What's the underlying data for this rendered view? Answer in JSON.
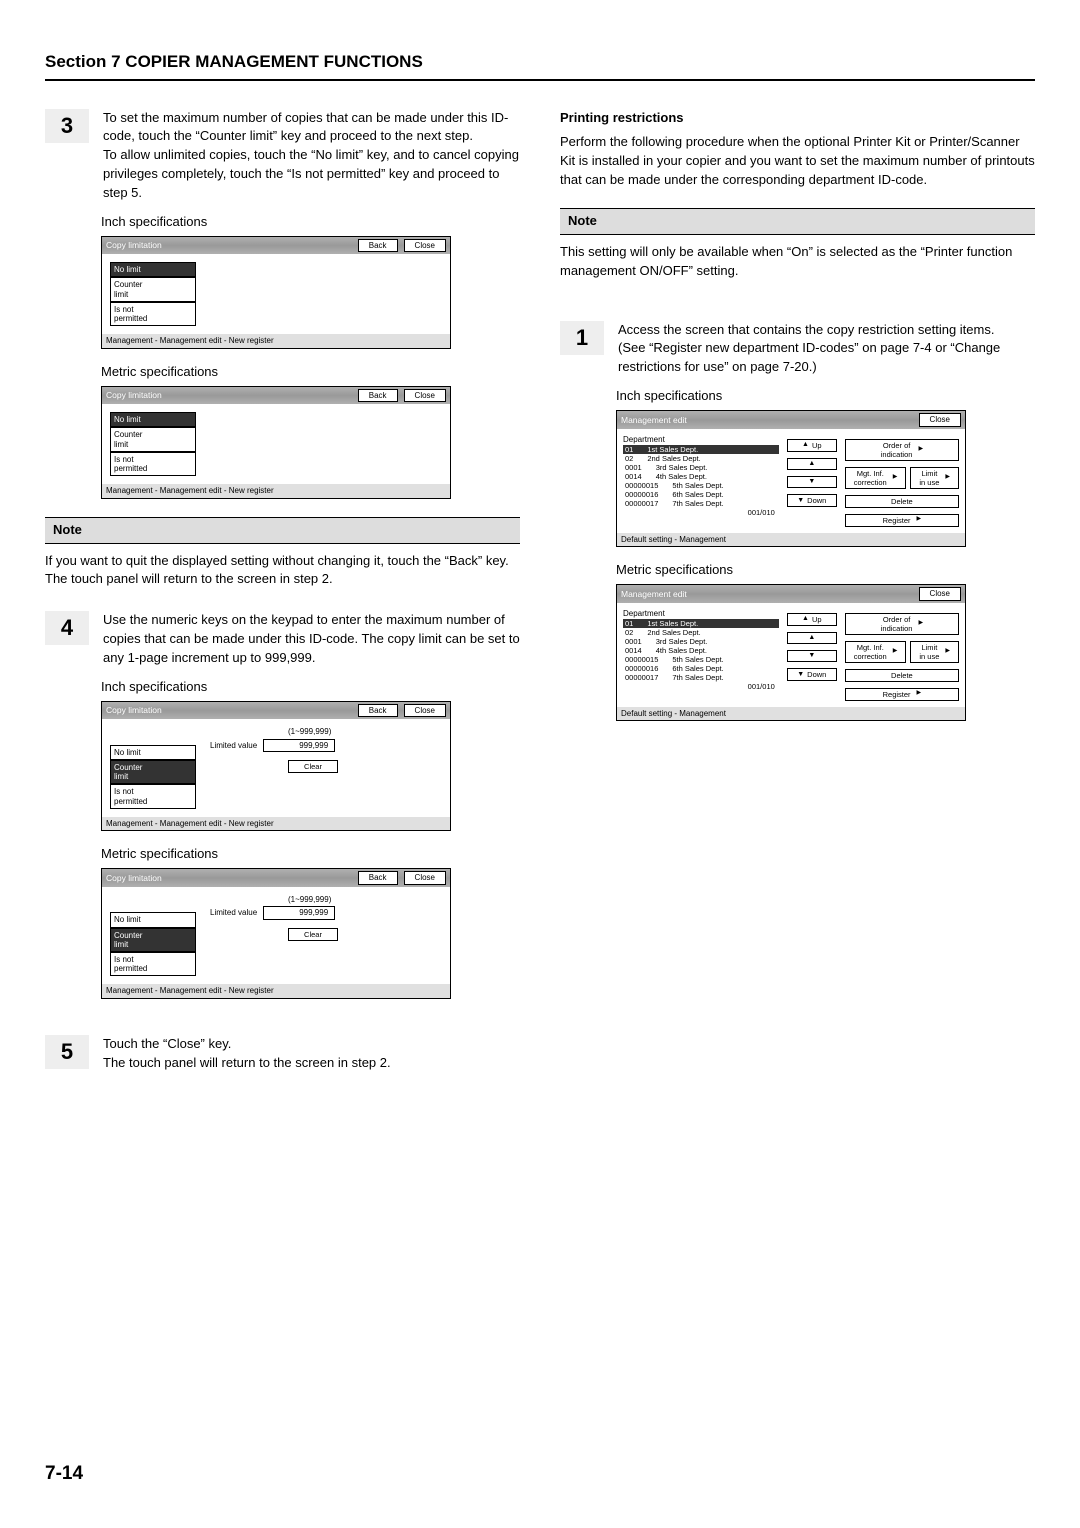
{
  "section_header": "Section 7  COPIER MANAGEMENT FUNCTIONS",
  "page_number": "7-14",
  "left": {
    "step3": {
      "num": "3",
      "text": "To set the maximum number of copies that can be made under this ID-code, touch the “Counter limit” key and proceed to the next step.\nTo allow unlimited copies, touch the “No limit” key, and to cancel copying privileges completely, touch the “Is not permitted” key and proceed to step 5."
    },
    "inch_label": "Inch specifications",
    "metric_label": "Metric specifications",
    "panel_a": {
      "title": "Copy limitation",
      "back": "Back",
      "close": "Close",
      "opts": {
        "a": "No limit",
        "b": "Counter\nlimit",
        "c": "Is not\npermitted"
      },
      "footer": "Management - Management edit - New register"
    },
    "note_label": "Note",
    "note_text": "If you want to quit the displayed setting without changing it, touch the “Back” key. The touch panel will return to the screen in step 2.",
    "step4": {
      "num": "4",
      "text": "Use the numeric keys on the keypad to enter the maximum number of copies that can be made under this ID-code. The copy limit can be set to any 1-page increment up to 999,999."
    },
    "panel_b": {
      "title": "Copy limitation",
      "back": "Back",
      "close": "Close",
      "range": "(1~999,999)",
      "lv_label": "Limited value",
      "lv_value": "999,999",
      "clear": "Clear",
      "opts": {
        "a": "No limit",
        "b": "Counter\nlimit",
        "c": "Is not\npermitted"
      },
      "footer": "Management - Management edit - New register"
    },
    "step5": {
      "num": "5",
      "text": "Touch the “Close” key.\nThe touch panel will return to the screen in step 2."
    }
  },
  "right": {
    "subhead": "Printing restrictions",
    "intro": "Perform the following procedure when the optional Printer Kit or Printer/Scanner Kit is installed in your copier and you want to set the maximum number of printouts that can be made under the corresponding department ID-code.",
    "note_label": "Note",
    "note_text": "This setting will only be available when “On” is selected as the “Printer function management ON/OFF” setting.",
    "step1": {
      "num": "1",
      "text": "Access the screen that contains the copy restriction setting items.\n(See “Register new department ID-codes” on page 7-4 or “Change restrictions for use” on page 7-20.)"
    },
    "inch_label": "Inch specifications",
    "metric_label": "Metric specifications",
    "mgmt": {
      "title": "Management edit",
      "close": "Close",
      "dept_head": "Department",
      "rows": [
        {
          "code": "01",
          "name": "1st Sales Dept."
        },
        {
          "code": "02",
          "name": "2nd Sales Dept."
        },
        {
          "code": "0001",
          "name": "3rd Sales Dept."
        },
        {
          "code": "0014",
          "name": "4th Sales Dept."
        },
        {
          "code": "00000015",
          "name": "5th Sales Dept."
        },
        {
          "code": "00000016",
          "name": "6th Sales Dept."
        },
        {
          "code": "00000017",
          "name": "7th Sales Dept."
        }
      ],
      "up": "Up",
      "down": "Down",
      "order": "Order of\nindication",
      "mgt": "Mgt. Inf.\ncorrection",
      "limit": "Limit\nin use",
      "delete": "Delete",
      "register": "Register",
      "pagecount": "001/010",
      "footer": "Default setting - Management"
    }
  }
}
